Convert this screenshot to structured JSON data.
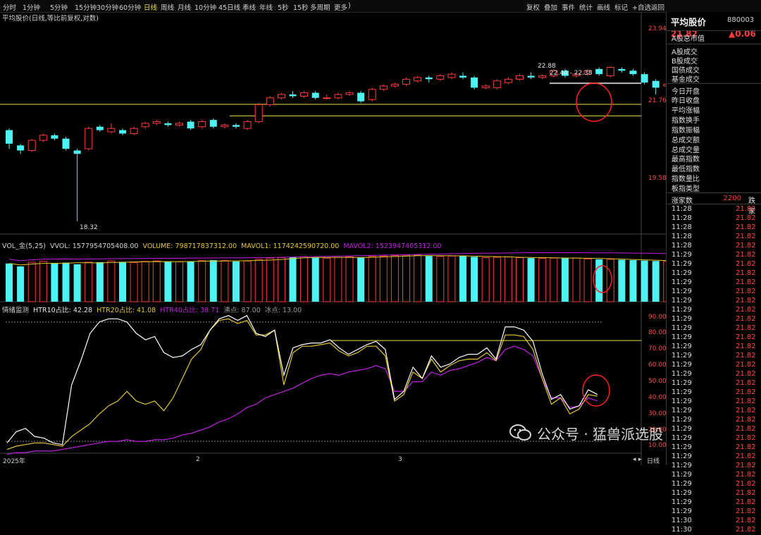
{
  "periods": [
    "分时",
    "1分钟",
    "5分钟",
    "15分钟",
    "30分钟",
    "60分钟",
    "日线",
    "周线",
    "月线",
    "10分钟",
    "45日线",
    "季线",
    "年线",
    "5秒",
    "15秒",
    "多周期",
    "更多"
  ],
  "active_period": "日线",
  "period_close": ")",
  "tools": [
    "复权",
    "叠加",
    "事件",
    "统计",
    "画线",
    "标记",
    "+自选",
    "返回"
  ],
  "chart_title": "平均股价(日线,等比前复权,对数)",
  "price_axis": {
    "top": "23.94",
    "mid": "21.76",
    "low": "19.58"
  },
  "annotations": {
    "high": "22.88",
    "range": "22.44 - 22.38",
    "low": "18.32"
  },
  "vol_legend": {
    "name": "VOL_金(5,25)",
    "vvol": "VVOL: 1577954705408.00",
    "volume": "VOLUME: 798717837312.00",
    "mavol1": "MAVOL1: 1174242590720.00",
    "mavol2": "MAVOL2: 1523947405312.00"
  },
  "senti_legend": {
    "name": "情绪监测",
    "htr10": "HTR10占比: 42.28",
    "htr20": "HTR20占比: 41.08",
    "htr40": "HTR40占比: 38.71",
    "boil": "沸点: 87.00",
    "ice": "冰点: 13.00"
  },
  "senti_axis": [
    "90.00",
    "80.00",
    "70.00",
    "60.00",
    "50.00",
    "40.00",
    "30.00",
    "20.00",
    "10.00"
  ],
  "date_axis": [
    "2025年",
    "2",
    "3"
  ],
  "bottom_tab": "日线",
  "colors": {
    "up": "#ff3b3b",
    "down": "#4df3f3",
    "white": "#ffffff",
    "yellow": "#e6c72e",
    "magenta": "#c020e0",
    "hline": "#e8e34a"
  },
  "right_panel": {
    "title": "平均股价",
    "code": "880003",
    "price": "21.82",
    "change": "▲0.06",
    "stats": [
      "A股总市值",
      "A股成交",
      "B股成交",
      "国债成交",
      "基金成交",
      "今日开盘",
      "昨日收盘",
      "平均涨幅",
      "指数换手",
      "指数振幅",
      "总成交额",
      "总成交量",
      "最高指数",
      "最低指数",
      "指数量比",
      "板指类型"
    ],
    "rise_label": "涨家数",
    "rise_value": "2200",
    "fall_label": "跌家",
    "ticks": [
      [
        "11:28",
        "21.82"
      ],
      [
        "11:28",
        "21.82"
      ],
      [
        "11:28",
        "21.82"
      ],
      [
        "11:28",
        "21.82"
      ],
      [
        "11:28",
        "21.82"
      ],
      [
        "11:29",
        "21.82"
      ],
      [
        "11:29",
        "21.82"
      ],
      [
        "11:29",
        "21.82"
      ],
      [
        "11:29",
        "21.82"
      ],
      [
        "11:29",
        "21.82"
      ],
      [
        "11:29",
        "21.82"
      ],
      [
        "11:29",
        "21.82"
      ],
      [
        "11:29",
        "21.82"
      ],
      [
        "11:29",
        "21.82"
      ],
      [
        "11:29",
        "21.82"
      ],
      [
        "11:29",
        "21.82"
      ],
      [
        "11:29",
        "21.82"
      ],
      [
        "11:29",
        "21.82"
      ],
      [
        "11:29",
        "21.82"
      ],
      [
        "11:29",
        "21.82"
      ],
      [
        "11:29",
        "21.82"
      ],
      [
        "11:29",
        "21.82"
      ],
      [
        "11:29",
        "21.82"
      ],
      [
        "11:29",
        "21.82"
      ],
      [
        "11:29",
        "21.82"
      ],
      [
        "11:29",
        "21.82"
      ],
      [
        "11:29",
        "21.82"
      ],
      [
        "11:29",
        "21.82"
      ],
      [
        "11:29",
        "21.82"
      ],
      [
        "11:29",
        "21.82"
      ],
      [
        "11:29",
        "21.82"
      ],
      [
        "11:29",
        "21.82"
      ],
      [
        "11:29",
        "21.82"
      ],
      [
        "11:29",
        "21.82"
      ],
      [
        "11:30",
        "21.82"
      ],
      [
        "11:30",
        "21.82"
      ]
    ]
  },
  "watermark": "公众号 · 猛兽派选股",
  "candles": [
    [
      21.0,
      20.6,
      21.05,
      20.45
    ],
    [
      20.55,
      20.4,
      20.6,
      20.3
    ],
    [
      20.4,
      20.7,
      20.75,
      20.35
    ],
    [
      20.7,
      20.85,
      20.9,
      20.65
    ],
    [
      20.85,
      20.75,
      20.9,
      20.7
    ],
    [
      20.75,
      20.45,
      20.8,
      20.4
    ],
    [
      20.4,
      20.3,
      20.45,
      18.32
    ],
    [
      20.45,
      21.05,
      21.1,
      20.4
    ],
    [
      21.1,
      21.0,
      21.15,
      20.95
    ],
    [
      20.95,
      21.05,
      21.2,
      20.9
    ],
    [
      21.0,
      20.9,
      21.05,
      20.85
    ],
    [
      20.9,
      21.05,
      21.1,
      20.85
    ],
    [
      21.1,
      21.2,
      21.25,
      21.05
    ],
    [
      21.2,
      21.25,
      21.3,
      21.15
    ],
    [
      21.2,
      21.15,
      21.25,
      21.1
    ],
    [
      21.15,
      21.2,
      21.25,
      21.1
    ],
    [
      21.25,
      21.05,
      21.3,
      21.0
    ],
    [
      21.1,
      21.25,
      21.3,
      21.05
    ],
    [
      21.3,
      21.1,
      21.35,
      21.05
    ],
    [
      21.1,
      21.15,
      21.2,
      21.05
    ],
    [
      21.15,
      21.1,
      21.2,
      21.05
    ],
    [
      21.05,
      21.25,
      21.3,
      21.0
    ],
    [
      21.25,
      21.75,
      21.8,
      21.2
    ],
    [
      21.75,
      21.95,
      22.0,
      21.7
    ],
    [
      21.95,
      22.05,
      22.1,
      21.9
    ],
    [
      22.05,
      22.0,
      22.15,
      21.95
    ],
    [
      22.0,
      22.1,
      22.15,
      21.95
    ],
    [
      22.1,
      21.95,
      22.15,
      21.9
    ],
    [
      21.95,
      21.95,
      22.05,
      21.9
    ],
    [
      21.95,
      22.05,
      22.1,
      21.9
    ],
    [
      22.05,
      22.1,
      22.15,
      22.0
    ],
    [
      22.1,
      21.85,
      22.15,
      21.8
    ],
    [
      21.9,
      22.2,
      22.25,
      21.85
    ],
    [
      22.2,
      22.3,
      22.35,
      22.15
    ],
    [
      22.3,
      22.35,
      22.4,
      22.25
    ],
    [
      22.35,
      22.5,
      22.55,
      22.3
    ],
    [
      22.45,
      22.55,
      22.6,
      22.4
    ],
    [
      22.55,
      22.5,
      22.6,
      22.4
    ],
    [
      22.5,
      22.6,
      22.65,
      22.45
    ],
    [
      22.55,
      22.65,
      22.7,
      22.5
    ],
    [
      22.6,
      22.55,
      22.7,
      22.5
    ],
    [
      22.55,
      22.25,
      22.6,
      22.2
    ],
    [
      22.25,
      22.3,
      22.35,
      22.2
    ],
    [
      22.25,
      22.45,
      22.5,
      22.2
    ],
    [
      22.4,
      22.5,
      22.55,
      22.35
    ],
    [
      22.5,
      22.6,
      22.65,
      22.45
    ],
    [
      22.6,
      22.55,
      22.7,
      22.5
    ],
    [
      22.55,
      22.6,
      22.65,
      22.5
    ],
    [
      22.6,
      22.75,
      22.8,
      22.55
    ],
    [
      22.75,
      22.6,
      22.8,
      22.55
    ],
    [
      22.6,
      22.65,
      22.7,
      22.55
    ],
    [
      22.65,
      22.75,
      22.8,
      22.6
    ],
    [
      22.8,
      22.65,
      22.85,
      22.6
    ],
    [
      22.6,
      22.85,
      22.88,
      22.55
    ],
    [
      22.8,
      22.75,
      22.85,
      22.7
    ],
    [
      22.75,
      22.65,
      22.8,
      22.6
    ],
    [
      22.65,
      22.4,
      22.7,
      22.35
    ],
    [
      22.45,
      22.25,
      22.5,
      22.05
    ],
    [
      22.3,
      22.35,
      22.4,
      22.25
    ],
    [
      22.3,
      22.35,
      22.4,
      22.3
    ],
    [
      22.3,
      22.38,
      22.45,
      22.25
    ]
  ],
  "volumes": [
    0.92,
    0.85,
    0.95,
    0.97,
    0.93,
    0.94,
    0.9,
    0.95,
    0.95,
    0.98,
    0.96,
    0.94,
    0.97,
    0.98,
    0.97,
    0.96,
    0.96,
    0.99,
    1.0,
    0.99,
    0.97,
    0.98,
    1.02,
    1.05,
    1.06,
    1.07,
    1.08,
    1.06,
    1.05,
    1.07,
    1.08,
    1.06,
    1.09,
    1.1,
    1.11,
    1.12,
    1.12,
    1.1,
    1.09,
    1.1,
    1.11,
    1.08,
    1.06,
    1.07,
    1.08,
    1.06,
    1.05,
    1.04,
    1.05,
    1.06,
    1.05,
    1.03,
    1.02,
    1.02,
    1.01,
    1.0,
    0.99,
    0.98,
    0.97,
    0.96,
    0.95
  ],
  "htr10": [
    12,
    19,
    21,
    16,
    15,
    12,
    11,
    48,
    63,
    80,
    87,
    89,
    89,
    87,
    80,
    76,
    78,
    68,
    65,
    66,
    70,
    73,
    82,
    89,
    91,
    88,
    91,
    80,
    78,
    82,
    54,
    71,
    73,
    74,
    74,
    76,
    71,
    67,
    70,
    73,
    75,
    70,
    39,
    44,
    59,
    52,
    66,
    59,
    61,
    65,
    67,
    67,
    71,
    64,
    84,
    84,
    82,
    75,
    55,
    39,
    42,
    33,
    35,
    45,
    42
  ],
  "htr20": [
    8,
    10,
    11,
    12,
    12,
    11,
    10,
    16,
    20,
    24,
    30,
    35,
    38,
    44,
    38,
    36,
    38,
    32,
    40,
    52,
    64,
    70,
    82,
    88,
    89,
    86,
    88,
    79,
    79,
    82,
    48,
    68,
    72,
    72,
    73,
    74,
    69,
    66,
    68,
    72,
    72,
    66,
    38,
    42,
    56,
    52,
    64,
    56,
    60,
    63,
    64,
    64,
    68,
    63,
    79,
    79,
    78,
    70,
    52,
    36,
    40,
    30,
    33,
    42,
    41
  ],
  "htr40": [
    5,
    6,
    6,
    7,
    7,
    7,
    8,
    9,
    10,
    11,
    12,
    13,
    13,
    14,
    13,
    13,
    14,
    14,
    15,
    17,
    18,
    20,
    22,
    25,
    27,
    30,
    34,
    36,
    40,
    42,
    44,
    46,
    49,
    52,
    54,
    55,
    54,
    56,
    57,
    58,
    60,
    58,
    44,
    44,
    50,
    50,
    56,
    54,
    57,
    58,
    60,
    62,
    65,
    63,
    70,
    72,
    70,
    66,
    52,
    40,
    40,
    34,
    35,
    40,
    38
  ]
}
